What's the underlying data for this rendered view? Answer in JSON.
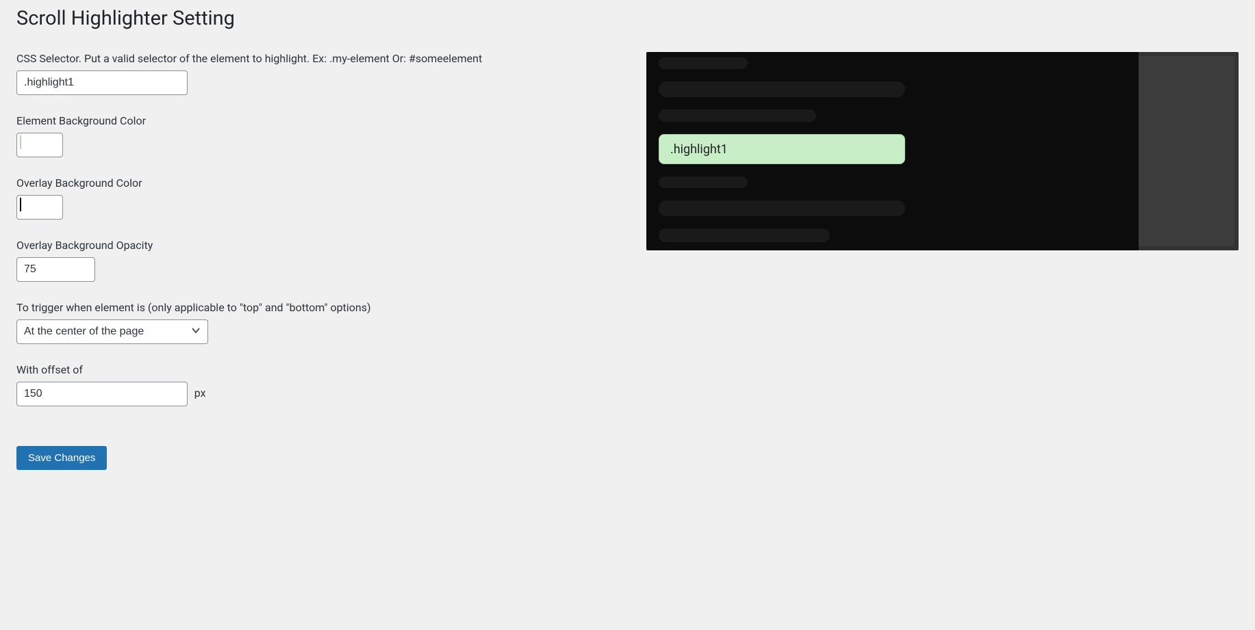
{
  "page": {
    "title": "Scroll Highlighter Setting"
  },
  "fields": {
    "selector": {
      "label": "CSS Selector. Put a valid selector of the element to highlight. Ex: .my-element Or: #someelement",
      "value": ".highlight1"
    },
    "element_bg": {
      "label": "Element Background Color",
      "value": "#c8eec8"
    },
    "overlay_bg": {
      "label": "Overlay Background Color",
      "value": "#000000"
    },
    "overlay_opacity": {
      "label": "Overlay Background Opacity",
      "value": "75"
    },
    "trigger": {
      "label": "To trigger when element is (only applicable to \"top\" and \"bottom\" options)",
      "value": "At the center of the page"
    },
    "offset": {
      "label": "With offset of",
      "value": "150",
      "unit": "px"
    }
  },
  "actions": {
    "save": "Save Changes"
  },
  "preview": {
    "highlight_text": ".highlight1"
  }
}
